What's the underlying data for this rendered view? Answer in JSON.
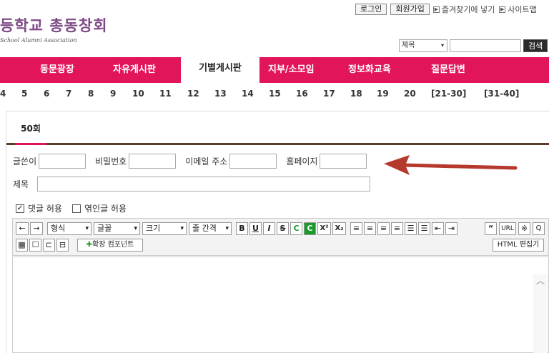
{
  "top_links": {
    "login": "로그인",
    "signup": "회원가입",
    "bookmark": "즐겨찾기에 넣기",
    "sitemap": "사이트맵"
  },
  "logo": {
    "title": "등학교 총동창회",
    "subtitle": "School Alumni Association"
  },
  "search": {
    "select_value": "제목",
    "input_value": "",
    "button": "검색"
  },
  "nav": {
    "items": [
      "동문광장",
      "자유게시판",
      "기별게시판",
      "지부/소모임",
      "정보화교육",
      "질문답변"
    ],
    "active_index": 2
  },
  "page_numbers": [
    "4",
    "5",
    "6",
    "7",
    "8",
    "9",
    "10",
    "11",
    "12",
    "13",
    "14",
    "15",
    "16",
    "17",
    "18",
    "19",
    "20",
    "[21-30]",
    "[31-40]"
  ],
  "tab": {
    "label": "50회"
  },
  "form": {
    "author_label": "글쓴이",
    "password_label": "비밀번호",
    "email_label": "이메일 주소",
    "homepage_label": "홈페이지",
    "subject_label": "제목",
    "allow_comment": "댓글 허용",
    "allow_comment_checked": true,
    "allow_trackback": "엮인글 허용",
    "allow_trackback_checked": false
  },
  "editor_toolbar": {
    "format": "형식",
    "font": "글꼴",
    "size": "크기",
    "line_spacing": "줄 간격",
    "bold": "B",
    "underline": "U",
    "italic": "I",
    "strike": "S",
    "color": "C",
    "bgcolor": "C",
    "superscript": "X²",
    "subscript": "X₂",
    "quote": "“",
    "url": "URL",
    "special": "※",
    "find": "Q",
    "extension": "확장 컴포넌트",
    "html_edit": "HTML 편집기"
  },
  "colors": {
    "nav_bg": "#e2155a",
    "logo": "#7e4b86",
    "arrow": "#b5392c"
  }
}
